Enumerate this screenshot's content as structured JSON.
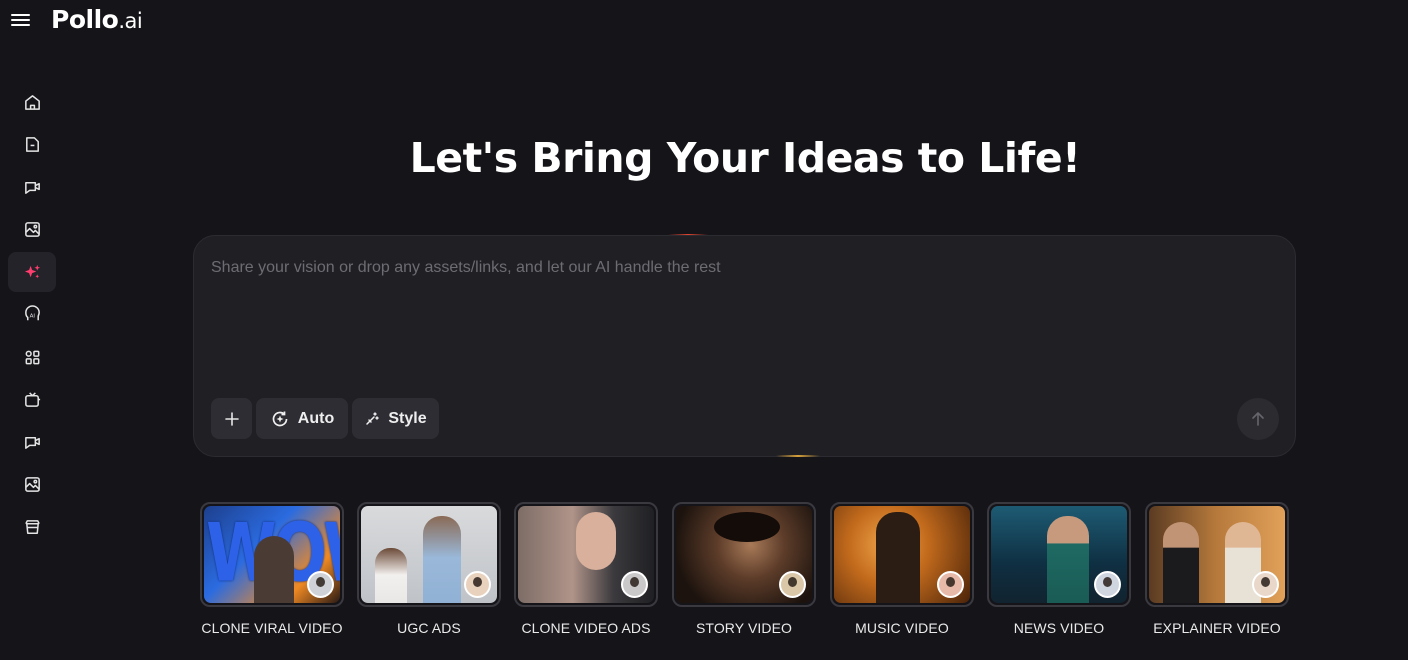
{
  "header": {
    "logo_main": "Pollo",
    "logo_suffix": ".ai",
    "menu_icon": "hamburger-menu-icon"
  },
  "sidebar": {
    "items": [
      {
        "icon": "home-icon",
        "active": false
      },
      {
        "icon": "folder-icon",
        "active": false
      },
      {
        "icon": "video-chat-icon",
        "active": false
      },
      {
        "icon": "image-gallery-icon",
        "active": false
      },
      {
        "icon": "sparkle-icon",
        "active": true
      },
      {
        "icon": "ai-head-icon",
        "active": false
      },
      {
        "icon": "apps-grid-icon",
        "active": false
      },
      {
        "icon": "tv-icon",
        "active": false
      },
      {
        "icon": "video-chat-2-icon",
        "active": false
      },
      {
        "icon": "image-gallery-2-icon",
        "active": false
      },
      {
        "icon": "archive-box-icon",
        "active": false
      }
    ],
    "accent_color": "#ff3d6e"
  },
  "hero": {
    "title": "Let's Bring Your Ideas to Life!"
  },
  "prompt": {
    "placeholder": "Share your vision or drop any assets/links, and let our AI handle the rest",
    "value": "",
    "add_icon": "plus-icon",
    "auto_label": "Auto",
    "auto_icon": "auto-mode-icon",
    "style_label": "Style",
    "style_icon": "magic-wand-icon",
    "send_icon": "arrow-up-icon"
  },
  "templates": [
    {
      "label": "CLONE VIRAL VIDEO",
      "overlay_text": "WOW"
    },
    {
      "label": "UGC ADS"
    },
    {
      "label": "CLONE VIDEO ADS"
    },
    {
      "label": "STORY VIDEO"
    },
    {
      "label": "MUSIC VIDEO"
    },
    {
      "label": "NEWS VIDEO"
    },
    {
      "label": "EXPLAINER VIDEO"
    }
  ],
  "colors": {
    "background": "#151419",
    "panel": "#202024",
    "pill": "#2e2d33",
    "text": "#ffffff",
    "placeholder": "#6d6c73"
  }
}
